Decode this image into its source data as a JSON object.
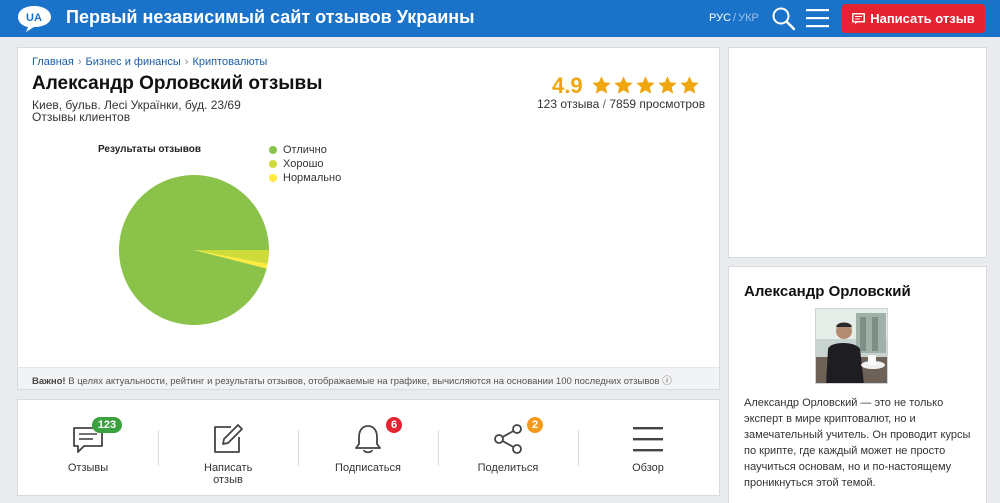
{
  "header": {
    "logo_text": "UA",
    "site_title": "Первый независимый сайт отзывов Украины",
    "lang_active": "РУС",
    "lang_sep": "/",
    "lang_inactive": "УКР",
    "write_review_label": "Написать отзыв",
    "colors": {
      "bar": "#1b73c9",
      "write_button": "#e52331"
    },
    "icons": [
      "search-icon",
      "menu-icon",
      "comment-icon"
    ]
  },
  "breadcrumb": [
    "Главная",
    "Бизнес и финансы",
    "Криптовалюты"
  ],
  "business": {
    "title": "Александр Орловский отзывы",
    "address": "Киев, бульв. Лесі Українки, буд. 23/69",
    "subtitle": "Отзывы клиентов",
    "rating": "4.9",
    "stars": 5,
    "reviews_count": "123 отзыва",
    "count_sep": "/",
    "views_count": "7859 просмотров"
  },
  "chart_data": {
    "type": "pie",
    "title": "Результаты отзывов",
    "categories": [
      "Отлично",
      "Хорошо",
      "Нормально"
    ],
    "values": [
      96,
      3,
      1
    ],
    "colors": [
      "#8bc34a",
      "#cddc39",
      "#ffeb3b"
    ],
    "legend_position": "right"
  },
  "note": {
    "bold": "Важно!",
    "text": " В целях актуальности, рейтинг и результаты отзывов, отображаемые на графике, вычисляются на основании 100 последних отзывов ⓘ"
  },
  "actions": [
    {
      "label": "Отзывы",
      "icon": "reviews-icon",
      "badge": "123",
      "badge_color": "#3aa13e"
    },
    {
      "label": "Написать отзыв",
      "icon": "edit-icon"
    },
    {
      "label": "Подписаться",
      "icon": "bell-icon",
      "badge": "6",
      "badge_color": "#e52331"
    },
    {
      "label": "Поделиться",
      "icon": "share-icon",
      "badge": "2",
      "badge_color": "#f39a1d"
    },
    {
      "label": "Обзор",
      "icon": "overview-menu-icon"
    }
  ],
  "about": {
    "title": "Александр Орловский",
    "text": "Александр Орловский — это не только эксперт в мире криптовалют, но и замечательный учитель. Он проводит курсы по крипте, где каждый может не просто научиться основам, но и по-настоящему проникнуться этой темой."
  }
}
